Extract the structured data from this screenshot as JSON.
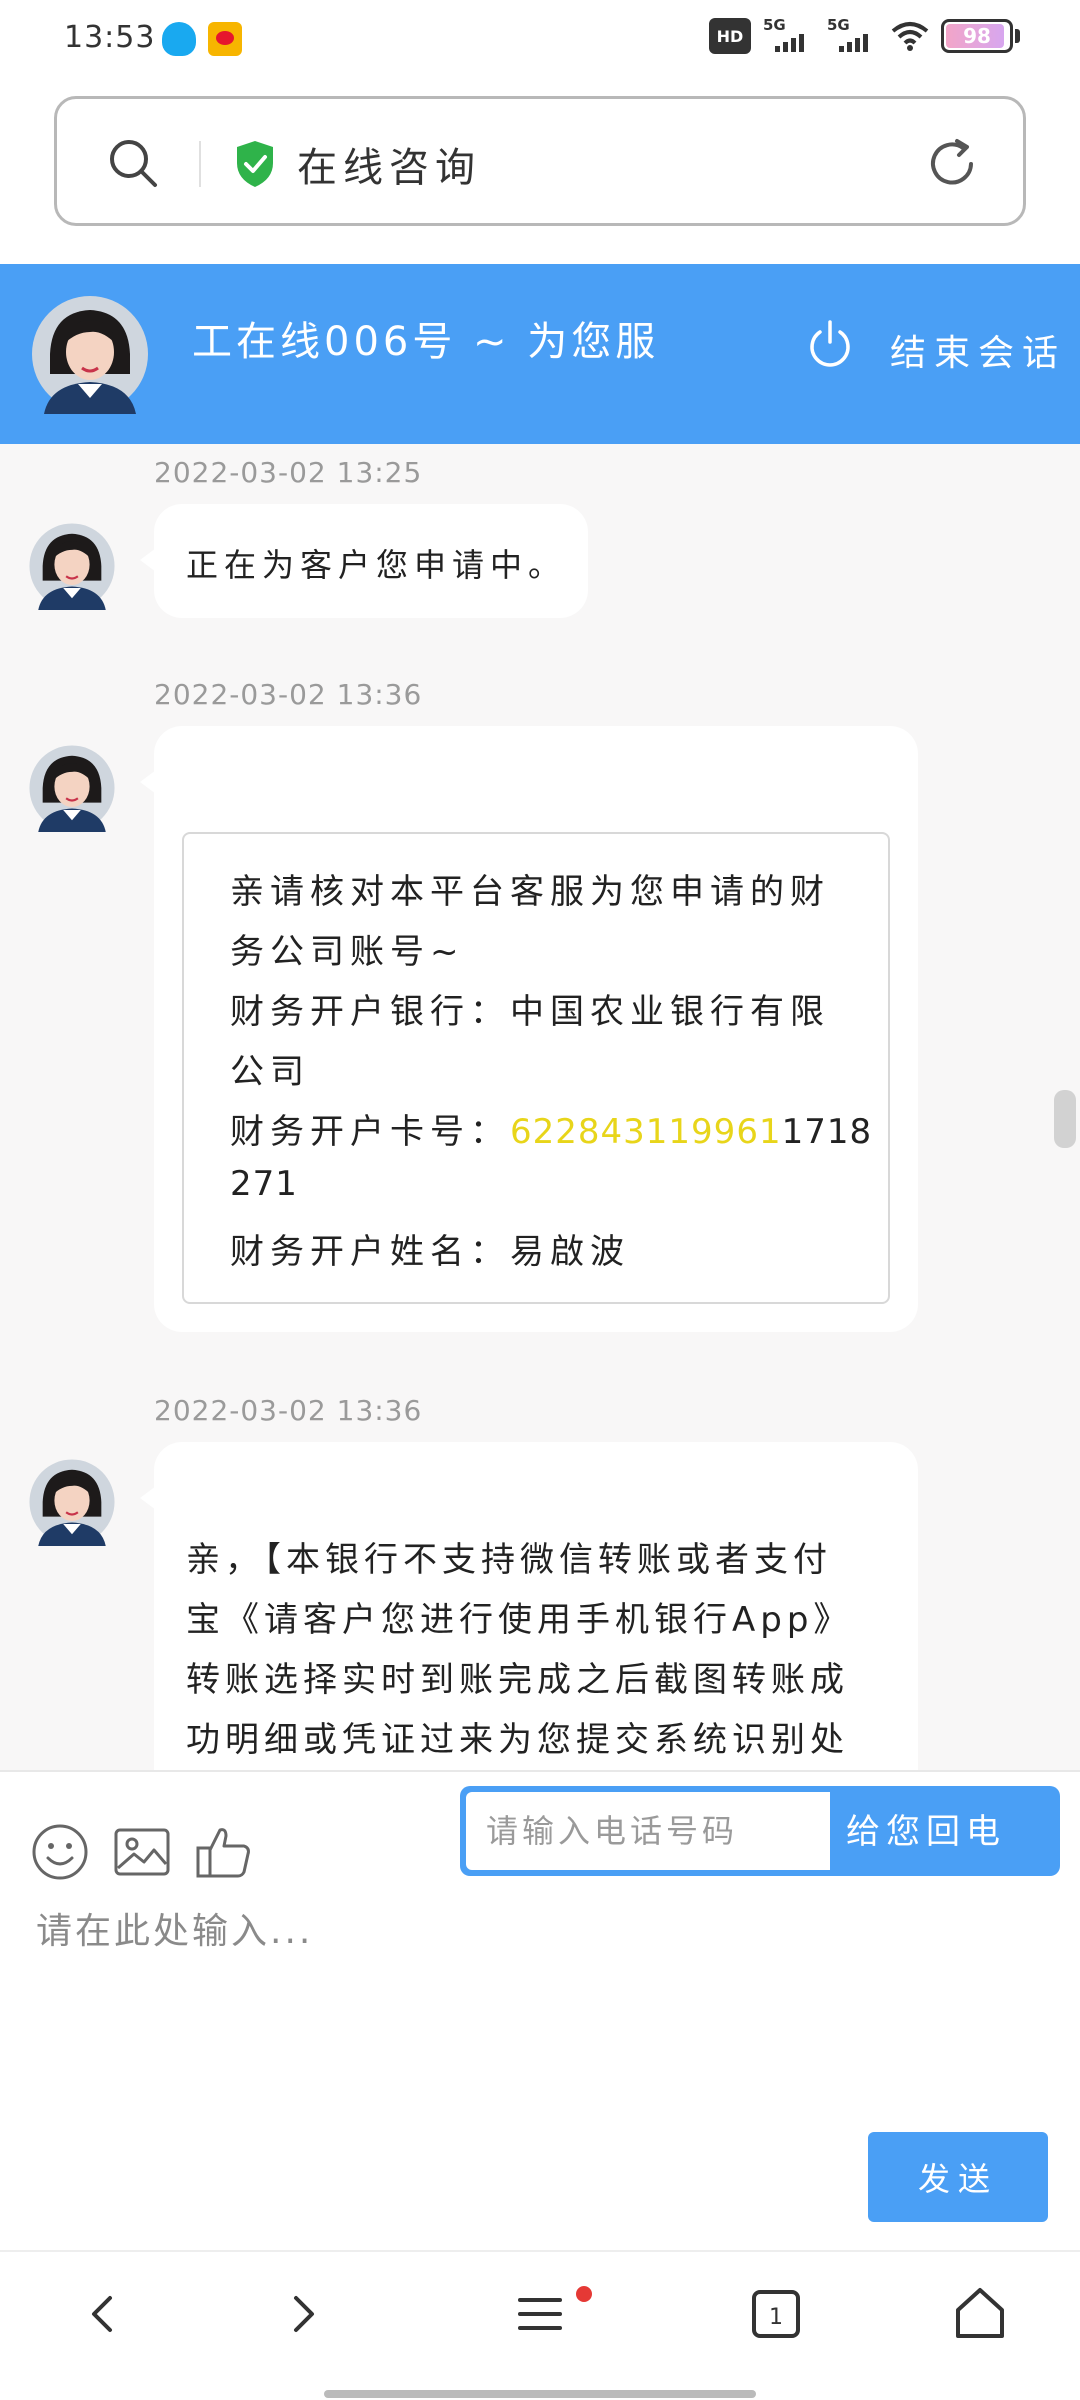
{
  "status_bar": {
    "time": "13:53",
    "network_1": "5G",
    "network_2": "5G",
    "hd_label": "HD",
    "battery": "98"
  },
  "search_bar": {
    "title": "在线咨询",
    "icons": [
      "search-icon",
      "shield-check-icon",
      "reload-icon"
    ]
  },
  "header": {
    "agent_name": "工在线006号 ~ 为您服",
    "end_session": "结束会话",
    "brand_color": "#4a9ff5"
  },
  "messages": [
    {
      "timestamp": "2022-03-02 13:25",
      "lines": [
        "正在为客户您申请中。"
      ]
    },
    {
      "timestamp": "2022-03-02 13:36",
      "box_lines": [
        "亲请核对本平台客服为您申请的财",
        "务公司账号~",
        "财务开户银行：中国农业银行有限",
        "公司",
        "财务开户卡号：",
        "271",
        "财务开户姓名：易啟波"
      ],
      "account_highlight": "622843119961",
      "account_rest": "1718",
      "highlight_color": "#e8d51a"
    },
    {
      "timestamp": "2022-03-02 13:36",
      "lines": [
        "亲，【本银行不支持微信转账或者支付",
        "宝《请客户您进行使用手机银行App》",
        "转账选择实时到账完成之后截图转账成",
        "功明细或凭证过来为您提交系统识别处"
      ]
    }
  ],
  "input_area": {
    "phone_placeholder": "请输入电话号码",
    "callback_label": "给您回电",
    "message_placeholder": "请在此处输入...",
    "send_label": "发送",
    "tool_icons": [
      "emoji-icon",
      "image-icon",
      "thumbs-up-icon"
    ]
  },
  "bottom_nav": {
    "buttons": [
      "back-icon",
      "forward-icon",
      "menu-icon",
      "tabs-icon",
      "home-icon"
    ],
    "tabs_count": "1"
  }
}
